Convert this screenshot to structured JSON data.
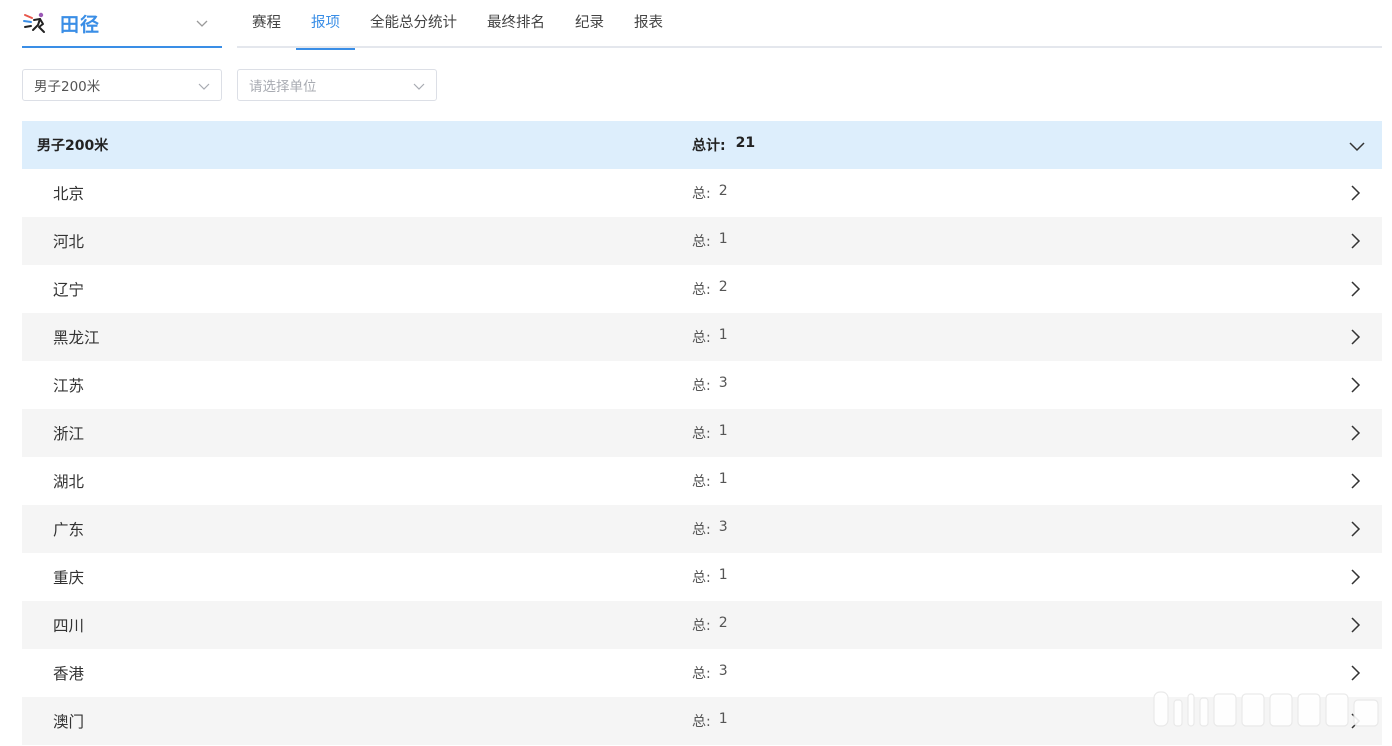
{
  "header": {
    "sport": {
      "name": "田径",
      "logo_icon": "athletics-logo-icon",
      "chevron_icon": "chevron-down-icon"
    },
    "tabs": [
      {
        "label": "赛程",
        "active": false
      },
      {
        "label": "报项",
        "active": true
      },
      {
        "label": "全能总分统计",
        "active": false
      },
      {
        "label": "最终排名",
        "active": false
      },
      {
        "label": "纪录",
        "active": false
      },
      {
        "label": "报表",
        "active": false
      }
    ]
  },
  "filters": {
    "event": {
      "value": "男子200米"
    },
    "unit": {
      "placeholder": "请选择单位"
    }
  },
  "colors": {
    "accent": "#3a8ee6",
    "header_bg": "#ddeefc",
    "row_alt_bg": "#f5f5f5"
  },
  "group": {
    "name": "男子200米",
    "total_label": "总计:",
    "total_value": "21",
    "expand_icon": "chevron-down-icon"
  },
  "rows": [
    {
      "name": "北京",
      "total_label": "总:",
      "total_value": "2"
    },
    {
      "name": "河北",
      "total_label": "总:",
      "total_value": "1"
    },
    {
      "name": "辽宁",
      "total_label": "总:",
      "total_value": "2"
    },
    {
      "name": "黑龙江",
      "total_label": "总:",
      "total_value": "1"
    },
    {
      "name": "江苏",
      "total_label": "总:",
      "total_value": "3"
    },
    {
      "name": "浙江",
      "total_label": "总:",
      "total_value": "1"
    },
    {
      "name": "湖北",
      "total_label": "总:",
      "total_value": "1"
    },
    {
      "name": "广东",
      "total_label": "总:",
      "total_value": "3"
    },
    {
      "name": "重庆",
      "total_label": "总:",
      "total_value": "1"
    },
    {
      "name": "四川",
      "total_label": "总:",
      "total_value": "2"
    },
    {
      "name": "香港",
      "total_label": "总:",
      "total_value": "3"
    },
    {
      "name": "澳门",
      "total_label": "总:",
      "total_value": "1"
    }
  ]
}
